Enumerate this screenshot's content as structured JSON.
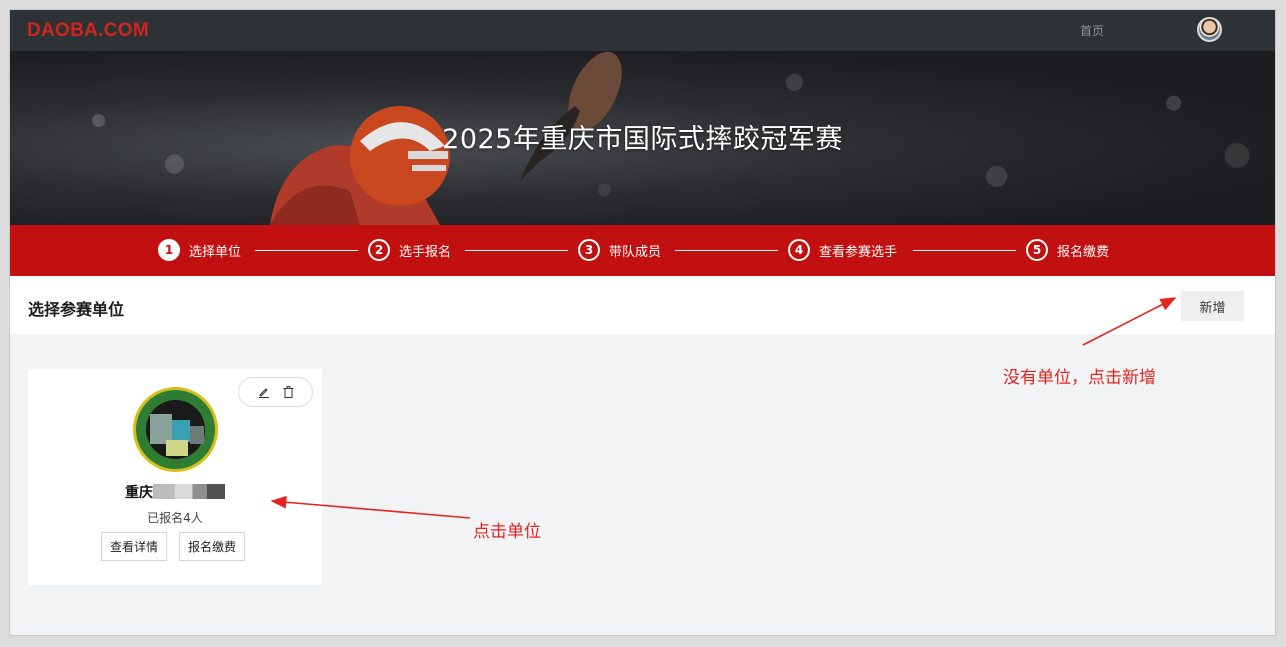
{
  "header": {
    "logo": "DAOBA.COM",
    "nav_home": "首页"
  },
  "banner": {
    "title": "2025年重庆市国际式摔跤冠军赛"
  },
  "steps": [
    {
      "num": "1",
      "label": "选择单位",
      "active": true
    },
    {
      "num": "2",
      "label": "选手报名",
      "active": false
    },
    {
      "num": "3",
      "label": "带队成员",
      "active": false
    },
    {
      "num": "4",
      "label": "查看参赛选手",
      "active": false
    },
    {
      "num": "5",
      "label": "报名缴费",
      "active": false
    }
  ],
  "section": {
    "title": "选择参赛单位",
    "add_label": "新增"
  },
  "card": {
    "name_visible_start": "重庆",
    "name_visible_end": "",
    "count": "已报名4人",
    "detail_label": "查看详情",
    "pay_label": "报名缴费"
  },
  "annotations": {
    "add_hint": "没有单位，点击新增",
    "card_hint": "点击单位"
  },
  "colors": {
    "brand_red": "#c20f0f",
    "annotation_red": "#e5231f",
    "topbar": "#2d3236"
  }
}
